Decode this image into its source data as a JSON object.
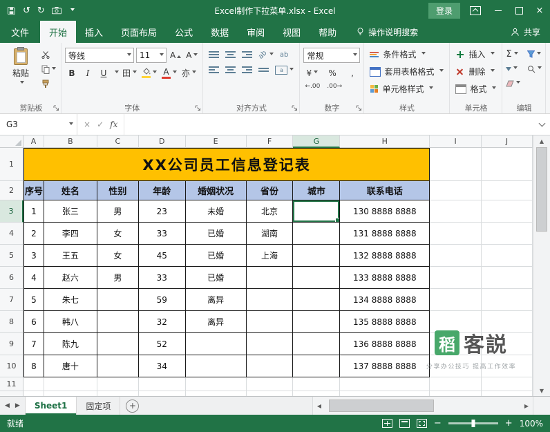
{
  "window": {
    "title": "Excel制作下拉菜单.xlsx -  Excel",
    "login": "登录"
  },
  "tabs": {
    "file": "文件",
    "items": [
      "开始",
      "插入",
      "页面布局",
      "公式",
      "数据",
      "审阅",
      "视图",
      "帮助"
    ],
    "active": "开始",
    "tell_me": "操作说明搜索",
    "share": "共享"
  },
  "ribbon": {
    "clipboard": {
      "label": "剪贴板",
      "paste": "粘贴"
    },
    "font": {
      "label": "字体",
      "name": "等线",
      "size": "11",
      "bold": "B",
      "italic": "I",
      "underline": "U",
      "borders": "田",
      "font_color": "A",
      "phonetic": "亦"
    },
    "alignment": {
      "label": "对齐方式"
    },
    "number": {
      "label": "数字",
      "format": "常规",
      "currency": "¥",
      "percent": "%",
      "comma": ",",
      "increase_decimal": "←.00",
      "decrease_decimal": ".00→"
    },
    "styles": {
      "label": "样式",
      "items": [
        "条件格式",
        "套用表格格式",
        "单元格样式"
      ]
    },
    "cells": {
      "label": "单元格",
      "items": [
        "插入",
        "删除",
        "格式"
      ]
    },
    "editing": {
      "label": "编辑",
      "autosum": "Σ"
    }
  },
  "formula_bar": {
    "name_box": "G3",
    "cancel": "×",
    "enter": "✓",
    "fx": "fx",
    "value": ""
  },
  "sheet": {
    "col_headers": [
      "A",
      "B",
      "C",
      "D",
      "E",
      "F",
      "G",
      "H",
      "I",
      "J"
    ],
    "row_headers": [
      "1",
      "2",
      "3",
      "4",
      "5",
      "6",
      "7",
      "8",
      "9",
      "10",
      "11"
    ],
    "selected_cell": {
      "column": "G",
      "row": "3"
    },
    "title": "XX公司员工信息登记表",
    "table_headers": [
      "序号",
      "姓名",
      "性别",
      "年龄",
      "婚姻状况",
      "省份",
      "城市",
      "联系电话"
    ],
    "records": [
      [
        "1",
        "张三",
        "男",
        "23",
        "未婚",
        "北京",
        "",
        "130 8888 8888"
      ],
      [
        "2",
        "李四",
        "女",
        "33",
        "已婚",
        "湖南",
        "",
        "131 8888 8888"
      ],
      [
        "3",
        "王五",
        "女",
        "45",
        "已婚",
        "上海",
        "",
        "132 8888 8888"
      ],
      [
        "4",
        "赵六",
        "男",
        "33",
        "已婚",
        "",
        "",
        "133 8888 8888"
      ],
      [
        "5",
        "朱七",
        "",
        "59",
        "离异",
        "",
        "",
        "134 8888 8888"
      ],
      [
        "6",
        "韩八",
        "",
        "32",
        "离异",
        "",
        "",
        "135 8888 8888"
      ],
      [
        "7",
        "陈九",
        "",
        "52",
        "",
        "",
        "",
        "136 8888 8888"
      ],
      [
        "8",
        "唐十",
        "",
        "34",
        "",
        "",
        "",
        "137 8888 8888"
      ]
    ]
  },
  "sheet_tabs": {
    "items": [
      "Sheet1",
      "固定项"
    ],
    "active": "Sheet1"
  },
  "status": {
    "mode": "就绪",
    "zoom": "100%"
  },
  "watermark": {
    "badge": "稻",
    "name": "客説",
    "tagline": "分享办公技巧 提高工作效率"
  },
  "icons": {
    "undo": "↺",
    "redo": "↻",
    "close": "×",
    "tab_prev": "◀",
    "tab_next": "▶",
    "scroll_up": "▲",
    "scroll_down": "▼",
    "scroll_left": "◀",
    "scroll_right": "▶",
    "new_sheet": "+",
    "zoom_out": "−",
    "zoom_in": "+",
    "grow_font": "A",
    "shrink_font": "A",
    "orientation": "ab",
    "wrap": "ab",
    "merge": "a"
  },
  "colors": {
    "brand_green": "#217346",
    "title_fill": "#FFC000",
    "header_fill": "#B4C6E7",
    "selection": "#217346"
  }
}
